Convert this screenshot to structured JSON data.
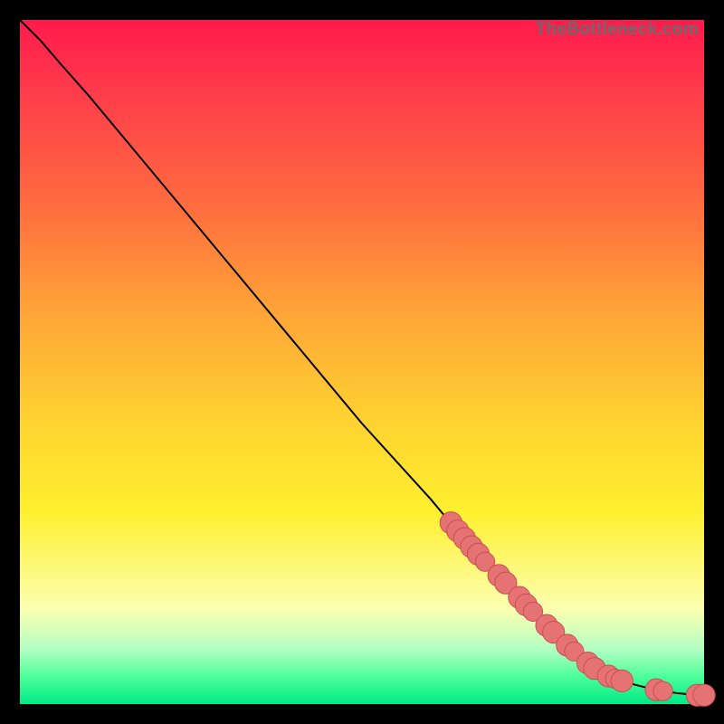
{
  "watermark": "TheBottleneck.com",
  "colors": {
    "line": "#000000",
    "marker_fill": "#e57373",
    "marker_stroke": "#c84f4f"
  },
  "chart_data": {
    "type": "line",
    "title": "",
    "xlabel": "",
    "ylabel": "",
    "xlim": [
      0,
      100
    ],
    "ylim": [
      0,
      100
    ],
    "grid": false,
    "legend": false,
    "series": [
      {
        "name": "curve",
        "x": [
          0,
          3,
          6,
          10,
          15,
          20,
          30,
          40,
          50,
          60,
          65,
          70,
          75,
          80,
          85,
          88,
          90,
          92,
          94,
          96,
          98,
          100
        ],
        "y": [
          100,
          97,
          93.5,
          89,
          83,
          77,
          65,
          53,
          41,
          30,
          24,
          19,
          13.5,
          8.5,
          4.5,
          3.4,
          2.8,
          2.3,
          1.9,
          1.6,
          1.4,
          1.3
        ]
      }
    ],
    "markers": [
      {
        "x": 63,
        "y": 26.5,
        "r": 1.6
      },
      {
        "x": 64,
        "y": 25.3,
        "r": 1.6
      },
      {
        "x": 65,
        "y": 24.2,
        "r": 1.6
      },
      {
        "x": 66,
        "y": 23.0,
        "r": 1.6
      },
      {
        "x": 67,
        "y": 21.9,
        "r": 1.6
      },
      {
        "x": 68,
        "y": 20.8,
        "r": 1.4
      },
      {
        "x": 70,
        "y": 18.8,
        "r": 1.6
      },
      {
        "x": 71,
        "y": 17.7,
        "r": 1.6
      },
      {
        "x": 73,
        "y": 15.6,
        "r": 1.6
      },
      {
        "x": 74,
        "y": 14.5,
        "r": 1.6
      },
      {
        "x": 75,
        "y": 13.5,
        "r": 1.4
      },
      {
        "x": 77,
        "y": 11.5,
        "r": 1.6
      },
      {
        "x": 78,
        "y": 10.5,
        "r": 1.6
      },
      {
        "x": 80,
        "y": 8.6,
        "r": 1.6
      },
      {
        "x": 81,
        "y": 7.7,
        "r": 1.4
      },
      {
        "x": 83,
        "y": 6.0,
        "r": 1.6
      },
      {
        "x": 84,
        "y": 5.2,
        "r": 1.6
      },
      {
        "x": 86,
        "y": 4.1,
        "r": 1.6
      },
      {
        "x": 87,
        "y": 3.7,
        "r": 1.4
      },
      {
        "x": 88,
        "y": 3.4,
        "r": 1.6
      },
      {
        "x": 93,
        "y": 2.1,
        "r": 1.6
      },
      {
        "x": 94,
        "y": 1.9,
        "r": 1.4
      },
      {
        "x": 99,
        "y": 1.3,
        "r": 1.6
      },
      {
        "x": 100,
        "y": 1.3,
        "r": 1.6
      }
    ]
  }
}
